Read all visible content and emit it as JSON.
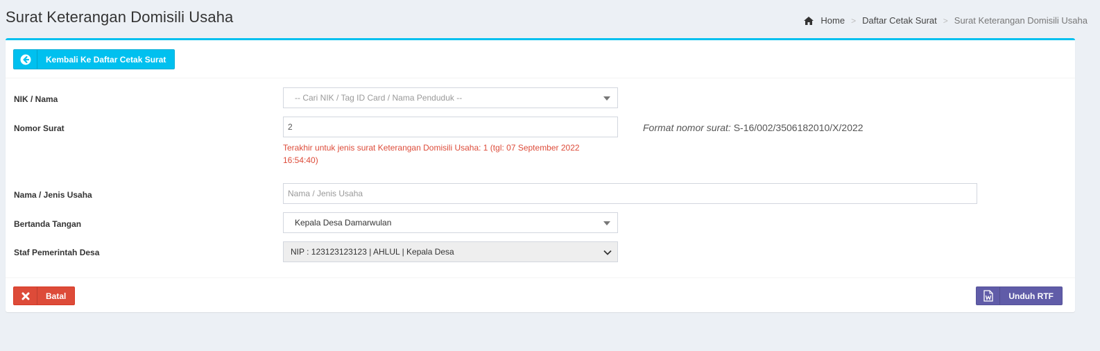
{
  "page": {
    "title": "Surat Keterangan Domisili Usaha"
  },
  "breadcrumb": {
    "home": "Home",
    "list": "Daftar Cetak Surat",
    "current": "Surat Keterangan Domisili Usaha",
    "separator": ">"
  },
  "header": {
    "back_label": "Kembali Ke Daftar Cetak Surat"
  },
  "form": {
    "nik": {
      "label": "NIK / Nama",
      "placeholder": "-- Cari NIK / Tag ID Card / Nama Penduduk --"
    },
    "nomor": {
      "label": "Nomor Surat",
      "value": "2",
      "last_info": "Terakhir untuk jenis surat Keterangan Domisili Usaha: 1 (tgl: 07 September 2022 16:54:40)",
      "format_label": "Format nomor surat:",
      "format_value": "S-16/002/3506182010/X/2022"
    },
    "usaha": {
      "label": "Nama / Jenis Usaha",
      "placeholder": "Nama / Jenis Usaha"
    },
    "ttd": {
      "label": "Bertanda Tangan",
      "value": "Kepala Desa Damarwulan"
    },
    "staf": {
      "label": "Staf Pemerintah Desa",
      "value": "NIP : 123123123123 | AHLUL | Kepala Desa"
    }
  },
  "footer": {
    "cancel_label": "Batal",
    "download_label": "Unduh RTF"
  },
  "colors": {
    "accent": "#00c0ef",
    "danger": "#dd4b39",
    "purple": "#605ca8",
    "background": "#ecf0f5"
  },
  "icons": {
    "home": "home-icon",
    "back": "arrow-circle-left-icon",
    "cancel": "close-icon",
    "word": "file-word-icon",
    "caret": "caret-down-icon",
    "chevron": "chevron-down-icon"
  }
}
